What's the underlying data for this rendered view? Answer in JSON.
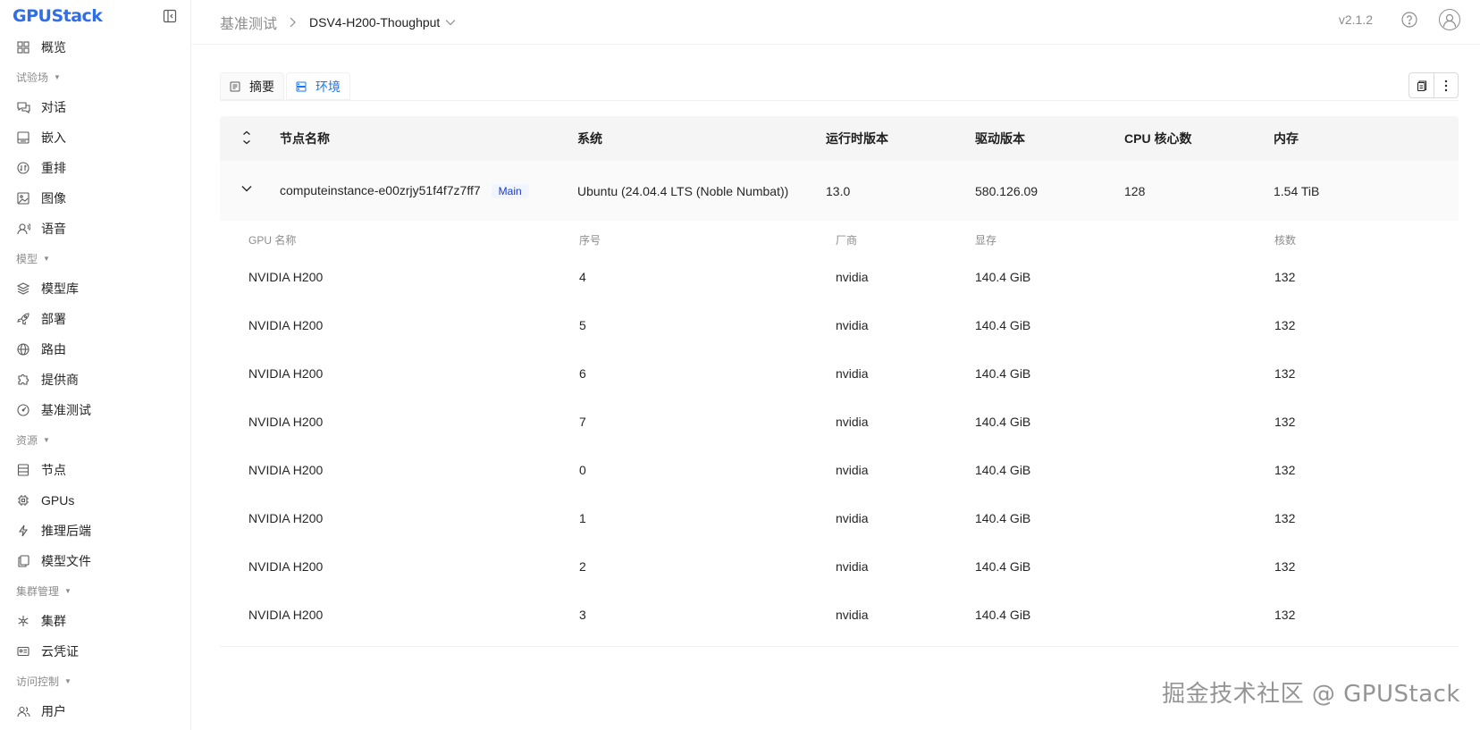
{
  "app": {
    "logo_text": "GPUStack",
    "version": "v2.1.2"
  },
  "sidebar": {
    "items": [
      {
        "type": "item",
        "label": "概览",
        "icon": "grid-icon"
      },
      {
        "type": "group",
        "label": "试验场"
      },
      {
        "type": "item",
        "label": "对话",
        "icon": "chat-icon"
      },
      {
        "type": "item",
        "label": "嵌入",
        "icon": "embed-icon"
      },
      {
        "type": "item",
        "label": "重排",
        "icon": "rerank-icon"
      },
      {
        "type": "item",
        "label": "图像",
        "icon": "image-icon"
      },
      {
        "type": "item",
        "label": "语音",
        "icon": "voice-icon"
      },
      {
        "type": "group",
        "label": "模型"
      },
      {
        "type": "item",
        "label": "模型库",
        "icon": "layers-icon"
      },
      {
        "type": "item",
        "label": "部署",
        "icon": "rocket-icon"
      },
      {
        "type": "item",
        "label": "路由",
        "icon": "globe-icon"
      },
      {
        "type": "item",
        "label": "提供商",
        "icon": "puzzle-icon"
      },
      {
        "type": "item",
        "label": "基准测试",
        "icon": "gauge-icon"
      },
      {
        "type": "group",
        "label": "资源"
      },
      {
        "type": "item",
        "label": "节点",
        "icon": "server-icon"
      },
      {
        "type": "item",
        "label": "GPUs",
        "icon": "chip-icon"
      },
      {
        "type": "item",
        "label": "推理后端",
        "icon": "bolt-icon"
      },
      {
        "type": "item",
        "label": "模型文件",
        "icon": "files-icon"
      },
      {
        "type": "group",
        "label": "集群管理"
      },
      {
        "type": "item",
        "label": "集群",
        "icon": "cluster-icon"
      },
      {
        "type": "item",
        "label": "云凭证",
        "icon": "credential-icon"
      },
      {
        "type": "group",
        "label": "访问控制"
      },
      {
        "type": "item",
        "label": "用户",
        "icon": "users-icon"
      }
    ]
  },
  "header": {
    "breadcrumb_root": "基准测试",
    "breadcrumb_current": "DSV4-H200-Thoughput"
  },
  "tabs": [
    {
      "label": "摘要",
      "icon": "summary-icon"
    },
    {
      "label": "环境",
      "icon": "environment-icon"
    }
  ],
  "node_table": {
    "headers": [
      "节点名称",
      "系统",
      "运行时版本",
      "驱动版本",
      "CPU 核心数",
      "内存"
    ],
    "row": {
      "name": "computeinstance-e00zrjy51f4f7z7ff7",
      "badge": "Main",
      "os": "Ubuntu (24.04.4 LTS (Noble Numbat))",
      "runtime": "13.0",
      "driver": "580.126.09",
      "cpu": "128",
      "memory": "1.54 TiB"
    }
  },
  "gpu_table": {
    "headers": [
      "GPU 名称",
      "序号",
      "厂商",
      "显存",
      "核数"
    ],
    "rows": [
      [
        "NVIDIA H200",
        "4",
        "nvidia",
        "140.4 GiB",
        "132"
      ],
      [
        "NVIDIA H200",
        "5",
        "nvidia",
        "140.4 GiB",
        "132"
      ],
      [
        "NVIDIA H200",
        "6",
        "nvidia",
        "140.4 GiB",
        "132"
      ],
      [
        "NVIDIA H200",
        "7",
        "nvidia",
        "140.4 GiB",
        "132"
      ],
      [
        "NVIDIA H200",
        "0",
        "nvidia",
        "140.4 GiB",
        "132"
      ],
      [
        "NVIDIA H200",
        "1",
        "nvidia",
        "140.4 GiB",
        "132"
      ],
      [
        "NVIDIA H200",
        "2",
        "nvidia",
        "140.4 GiB",
        "132"
      ],
      [
        "NVIDIA H200",
        "3",
        "nvidia",
        "140.4 GiB",
        "132"
      ]
    ]
  },
  "watermark": "掘金技术社区 @ GPUStack",
  "colors": {
    "accent": "#1677ff",
    "badge_text": "#1d39c4",
    "badge_bg": "#f0f5ff"
  }
}
